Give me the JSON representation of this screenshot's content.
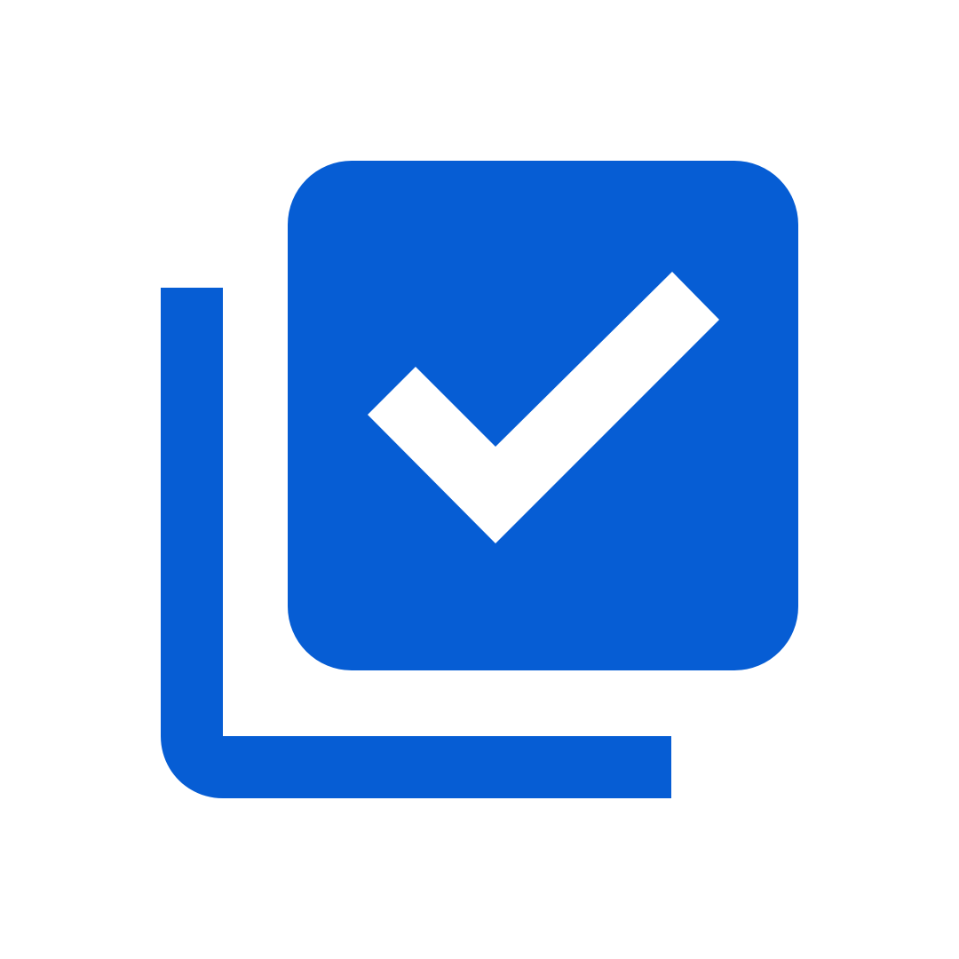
{
  "icon": {
    "name": "library-add-check-icon",
    "primary_color": "#065DD4",
    "check_color": "#FFFFFF",
    "background_color": "#FFFFFF"
  }
}
